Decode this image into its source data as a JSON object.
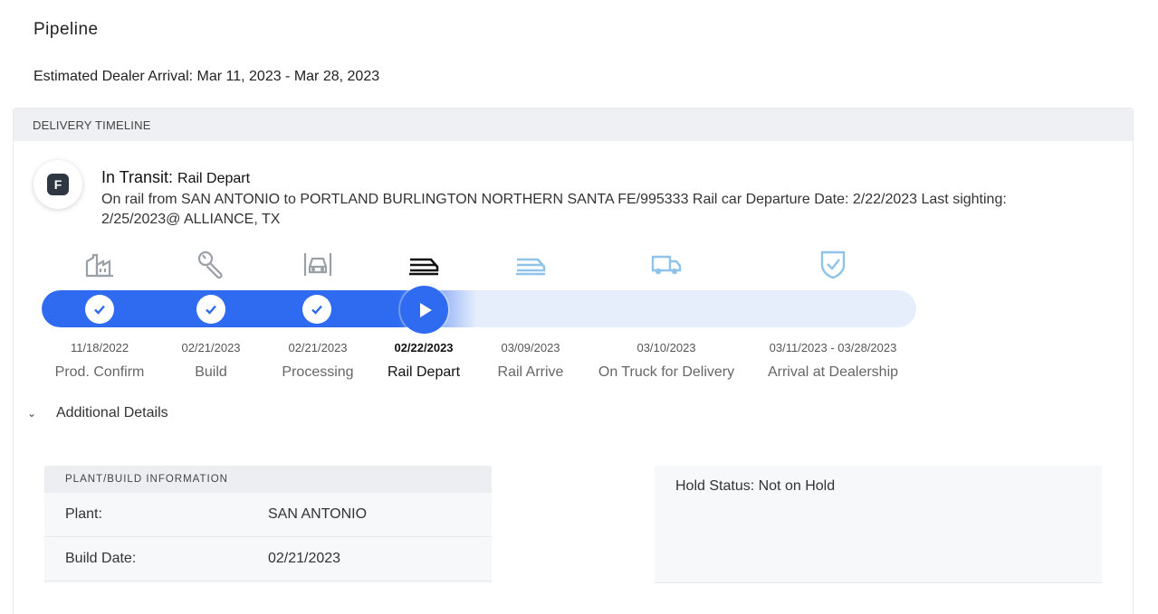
{
  "page": {
    "title": "Pipeline",
    "eta_label": "Estimated Dealer Arrival:",
    "eta_value": "Mar 11, 2023 - Mar 28, 2023"
  },
  "timeline": {
    "header": "DELIVERY TIMELINE",
    "badge_letter": "F",
    "status_main": "In Transit:",
    "status_sub": "Rail Depart",
    "description": "On rail from SAN ANTONIO to PORTLAND BURLINGTON NORTHERN SANTA FE/995333 Rail car Departure Date: 2/22/2023 Last sighting: 2/25/2023@ ALLIANCE, TX",
    "progress_fraction": 0.5,
    "stages": [
      {
        "date": "11/18/2022",
        "label": "Prod. Confirm",
        "icon": "factory-icon",
        "state": "done"
      },
      {
        "date": "02/21/2023",
        "label": "Build",
        "icon": "wrench-icon",
        "state": "done"
      },
      {
        "date": "02/21/2023",
        "label": "Processing",
        "icon": "vehicle-front-icon",
        "state": "done"
      },
      {
        "date": "02/22/2023",
        "label": "Rail Depart",
        "icon": "train-icon",
        "state": "current"
      },
      {
        "date": "03/09/2023",
        "label": "Rail Arrive",
        "icon": "train-arrive-icon",
        "state": "pending"
      },
      {
        "date": "03/10/2023",
        "label": "On Truck for Delivery",
        "icon": "truck-icon",
        "state": "pending"
      },
      {
        "date": "03/11/2023 - 03/28/2023",
        "label": "Arrival at Dealership",
        "icon": "shield-check-icon",
        "state": "pending"
      }
    ]
  },
  "details": {
    "toggle_label": "Additional Details",
    "plant_header": "PLANT/BUILD INFORMATION",
    "rows": [
      {
        "key": "Plant:",
        "value": "SAN ANTONIO"
      },
      {
        "key": "Build Date:",
        "value": "02/21/2023"
      }
    ],
    "hold_status": "Hold Status: Not on Hold"
  },
  "colors": {
    "accent": "#2f6bf0",
    "track": "#e6eefc",
    "done_icon": "#9aa0a6",
    "pending_icon": "#8fc3ea"
  }
}
